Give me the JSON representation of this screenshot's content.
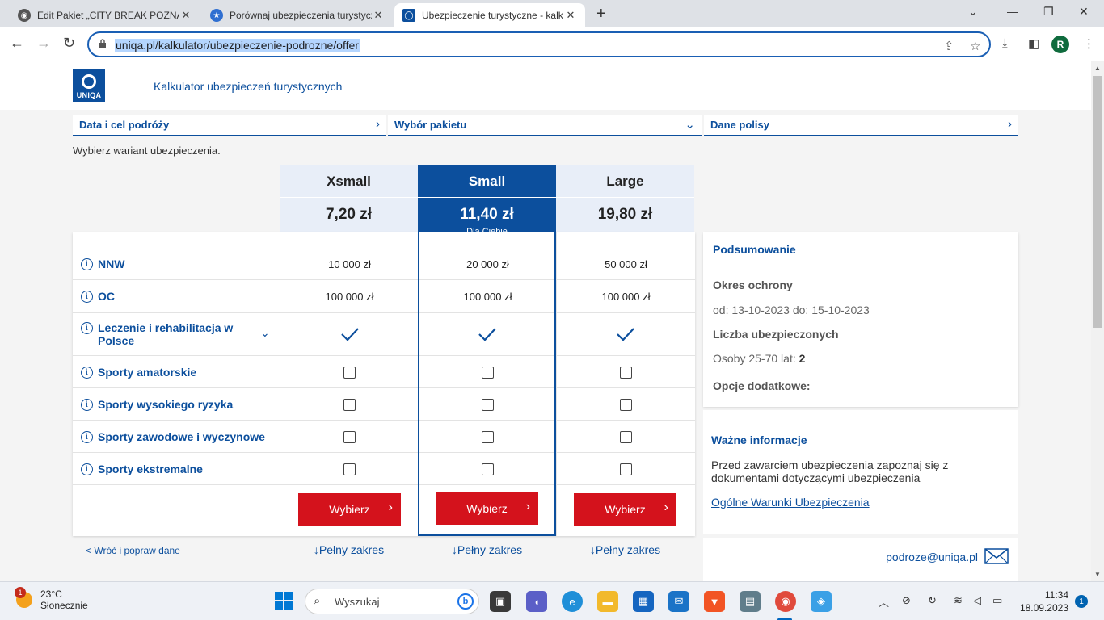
{
  "browser": {
    "tabs": [
      {
        "title": "Edit Pakiet „CITY BREAK POZNAŃ",
        "active": false
      },
      {
        "title": "Porównaj ubezpieczenia turystyczne",
        "active": false
      },
      {
        "title": "Ubezpieczenie turystyczne - kalk",
        "active": true
      }
    ],
    "url": "uniqa.pl/kalkulator/ubezpieczenie-podrozne/offer",
    "profile_initial": "R"
  },
  "header": {
    "logo_text": "UNIQA",
    "title": "Kalkulator ubezpieczeń turystycznych"
  },
  "steps": [
    {
      "label": "Data i cel podróży",
      "chevron": "›"
    },
    {
      "label": "Wybór pakietu",
      "chevron": "⌄"
    },
    {
      "label": "Dane polisy",
      "chevron": "›"
    }
  ],
  "hint": "Wybierz wariant ubezpieczenia.",
  "packages": [
    {
      "name": "Xsmall",
      "price": "7,20 zł",
      "selected": false
    },
    {
      "name": "Small",
      "price": "11,40 zł",
      "selected": true,
      "badge": "Dla Ciebie"
    },
    {
      "name": "Large",
      "price": "19,80 zł",
      "selected": false
    }
  ],
  "rows": [
    {
      "label": "NNW",
      "values": [
        "10 000 zł",
        "20 000 zł",
        "50 000 zł"
      ]
    },
    {
      "label": "OC",
      "values": [
        "100 000 zł",
        "100 000 zł",
        "100 000 zł"
      ]
    },
    {
      "label": "Leczenie i rehabilitacja w Polsce",
      "type": "check"
    },
    {
      "label": "Sporty amatorskie",
      "type": "box"
    },
    {
      "label": "Sporty wysokiego ryzyka",
      "type": "box"
    },
    {
      "label": "Sporty zawodowe i wyczynowe",
      "type": "box"
    },
    {
      "label": "Sporty ekstremalne",
      "type": "box"
    }
  ],
  "buttons": {
    "choose": "Wybierz"
  },
  "links": {
    "back": "< Wróć i popraw dane",
    "full_scope": "↓Pełny zakres"
  },
  "summary": {
    "title": "Podsumowanie",
    "period_label": "Okres ochrony",
    "period_value": "od: 13-10-2023 do: 15-10-2023",
    "insured_label": "Liczba ubezpieczonych",
    "insured_value_prefix": "Osoby 25-70 lat: ",
    "insured_value_count": "2",
    "extras_label": "Opcje dodatkowe:"
  },
  "important": {
    "title": "Ważne informacje",
    "text": "Przed zawarciem ubezpieczenia zapoznaj się z dokumentami dotyczącymi ubezpieczenia",
    "link": "Ogólne Warunki Ubezpieczenia"
  },
  "contact": {
    "email": "podroze@uniqa.pl"
  },
  "taskbar": {
    "weather_temp": "23°C",
    "weather_cond": "Słonecznie",
    "weather_badge": "1",
    "search_placeholder": "Wyszukaj",
    "time": "11:34",
    "date": "18.09.2023",
    "notifications": "1"
  },
  "colors": {
    "brand": "#0c4f9d",
    "button": "#d4121c"
  }
}
